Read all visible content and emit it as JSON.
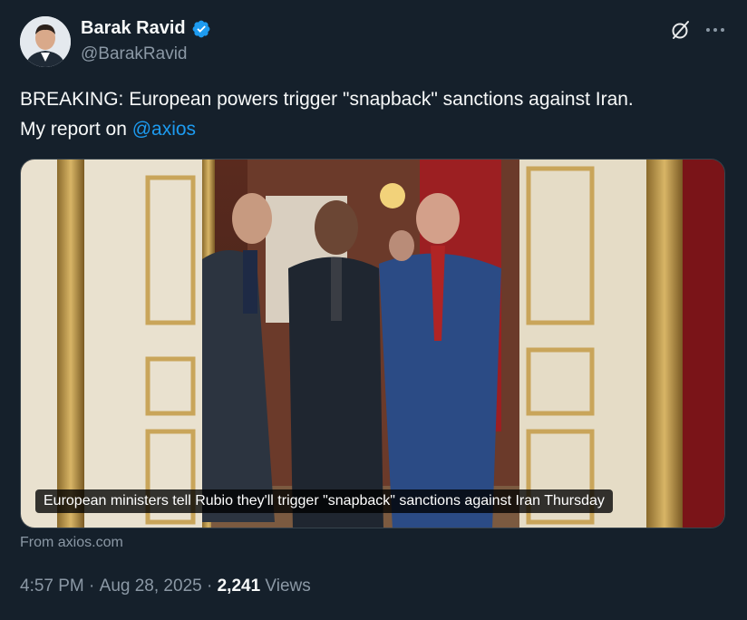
{
  "author": {
    "display_name": "Barak Ravid",
    "handle": "@BarakRavid",
    "verified": true
  },
  "tweet": {
    "text_line1": "BREAKING: European powers trigger \"snapback\" sanctions against Iran.",
    "text_line2_prefix": "My report on ",
    "mention": "@axios"
  },
  "card": {
    "caption": "European ministers tell Rubio they'll trigger \"snapback\" sanctions against Iran Thursday",
    "source": "From axios.com"
  },
  "meta": {
    "time": "4:57 PM",
    "separator": " · ",
    "date": "Aug 28, 2025",
    "views_count": "2,241",
    "views_label": " Views"
  },
  "icons": {
    "verified": "verified-badge-icon",
    "grok": "grok-icon",
    "more": "more-dots-icon"
  },
  "colors": {
    "background": "#15202b",
    "accent": "#1d9bf0",
    "secondary_text": "#8b98a5"
  }
}
